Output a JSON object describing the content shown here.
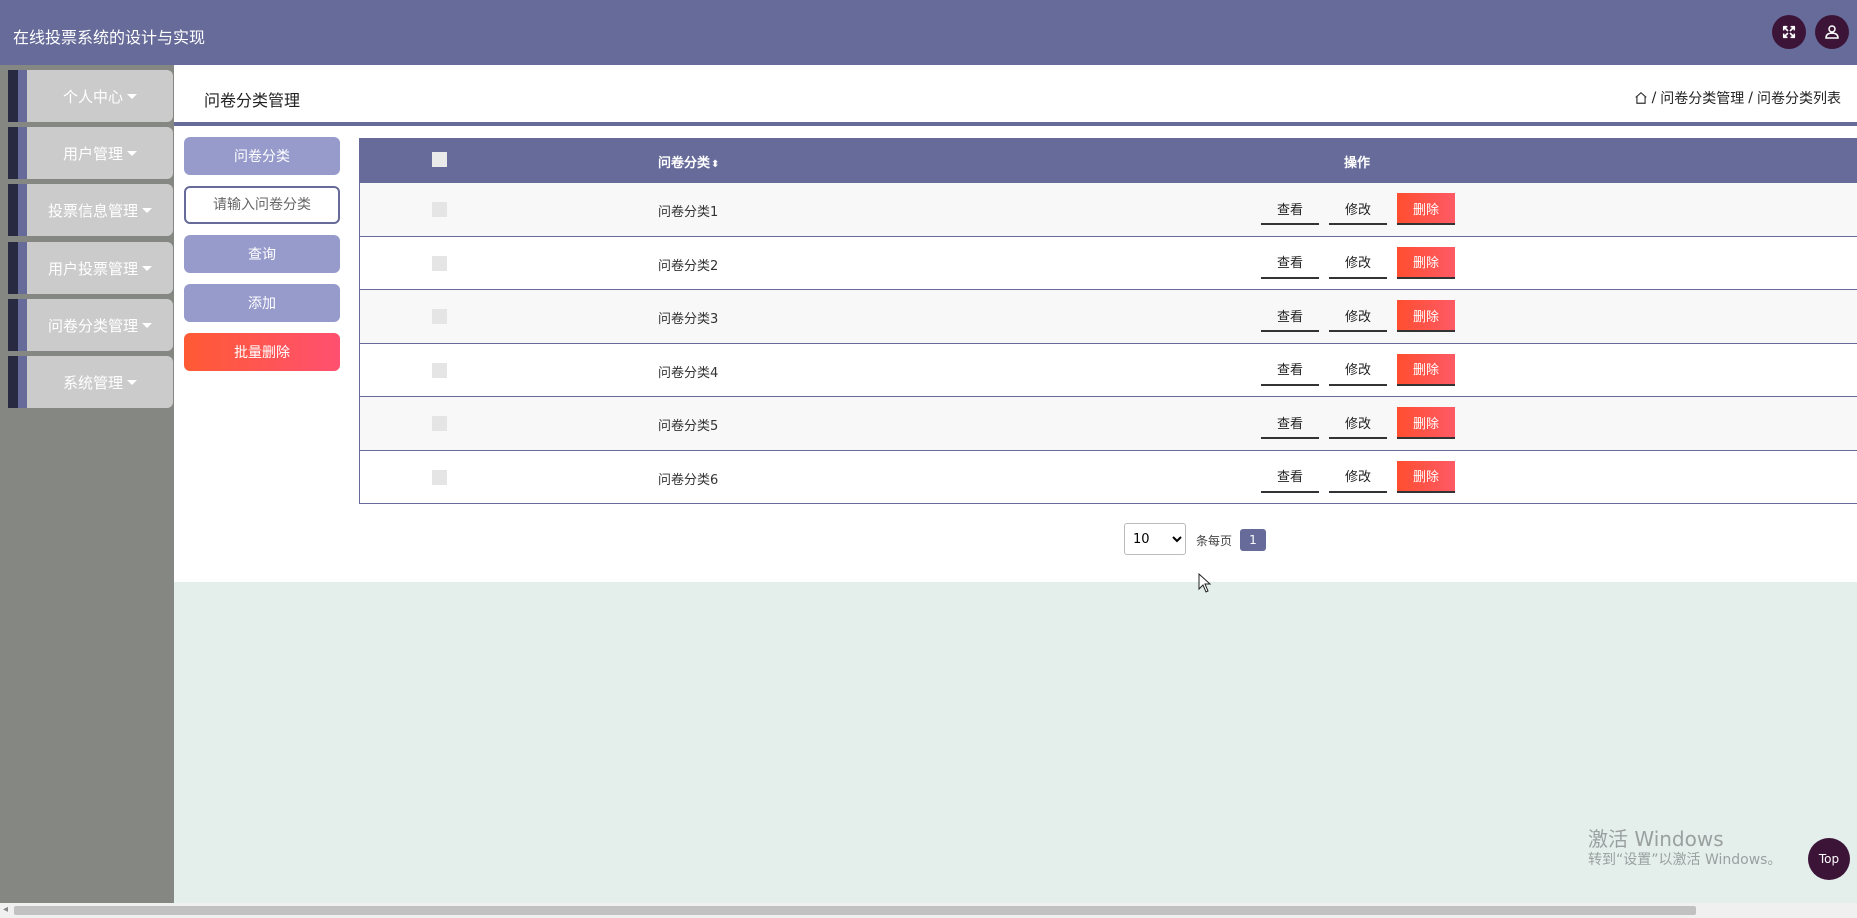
{
  "app": {
    "title": "在线投票系统的设计与实现"
  },
  "header_icons": [
    "fullscreen-icon",
    "user-icon"
  ],
  "sidebar": {
    "items": [
      {
        "label": "个人中心"
      },
      {
        "label": "用户管理"
      },
      {
        "label": "投票信息管理"
      },
      {
        "label": "用户投票管理"
      },
      {
        "label": "问卷分类管理"
      },
      {
        "label": "系统管理"
      }
    ]
  },
  "page": {
    "title": "问卷分类管理",
    "breadcrumb": [
      "问卷分类管理",
      "问卷分类列表"
    ],
    "breadcrumb_sep": "/"
  },
  "controls": {
    "category_label": "问卷分类",
    "search_placeholder": "请输入问卷分类",
    "search_button": "查询",
    "add_button": "添加",
    "batch_delete_button": "批量删除"
  },
  "table": {
    "columns": {
      "name": "问卷分类",
      "ops": "操作"
    },
    "sort_glyph": "⬍",
    "rows": [
      {
        "name": "问卷分类1"
      },
      {
        "name": "问卷分类2"
      },
      {
        "name": "问卷分类3"
      },
      {
        "name": "问卷分类4"
      },
      {
        "name": "问卷分类5"
      },
      {
        "name": "问卷分类6"
      }
    ],
    "actions": {
      "view": "查看",
      "edit": "修改",
      "delete": "删除"
    }
  },
  "pagination": {
    "page_size": "10",
    "page_size_label": "条每页",
    "current_page": "1"
  },
  "watermark": {
    "line1": "激活 Windows",
    "line2": "转到“设置”以激活 Windows。"
  },
  "top_button": "Top",
  "colors": {
    "primary": "#666b99",
    "primary_light": "#979bcc",
    "danger": "#ff5a34",
    "sidebar_bg": "#858782",
    "content_bg": "#e4efeb"
  }
}
